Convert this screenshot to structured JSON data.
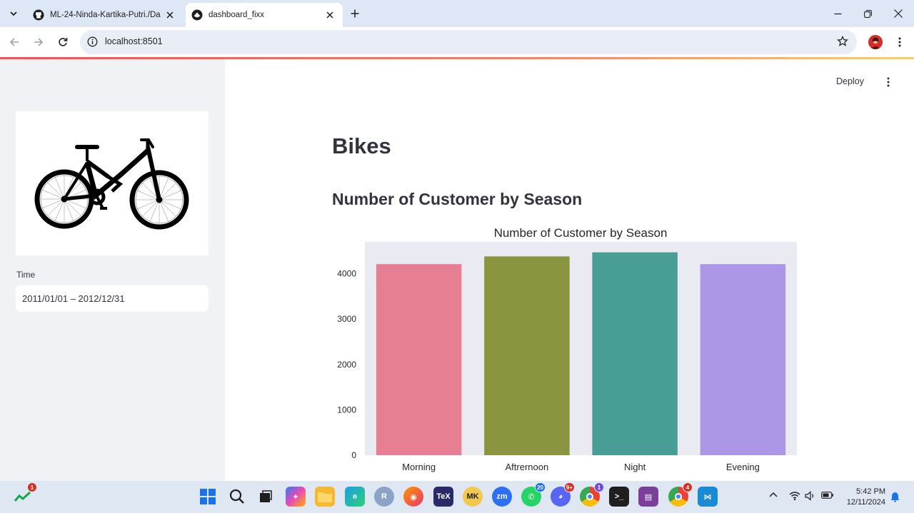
{
  "browser": {
    "tabs": [
      {
        "title": "ML-24-Ninda-Kartika-Putri./Da",
        "active": false
      },
      {
        "title": "dashboard_fixx",
        "active": true
      }
    ],
    "url": "localhost:8501"
  },
  "app": {
    "deploy_label": "Deploy",
    "title": "Bikes",
    "subheader": "Number of Customer by Season",
    "sidebar": {
      "time_label": "Time",
      "date_range": "2011/01/01 – 2012/12/31"
    }
  },
  "chart_data": {
    "type": "bar",
    "title": "Number of Customer by Season",
    "xlabel": "",
    "ylabel": "",
    "categories": [
      "Morning",
      "Aftrernoon",
      "Night",
      "Evening"
    ],
    "values": [
      4210,
      4380,
      4470,
      4210
    ],
    "colors": [
      "#e77f93",
      "#8b943f",
      "#489e95",
      "#ab97e6"
    ],
    "yticks": [
      0,
      1000,
      2000,
      3000,
      4000
    ],
    "ylim": [
      0,
      4700
    ],
    "background": "#eaeaf2",
    "grid": false
  },
  "taskbar": {
    "badges": {
      "tray_app": "1",
      "whatsapp": "20",
      "discord": "9+",
      "chrome_profile": "1",
      "chrome": "4"
    },
    "time": "5:42 PM",
    "date": "12/11/2024"
  }
}
